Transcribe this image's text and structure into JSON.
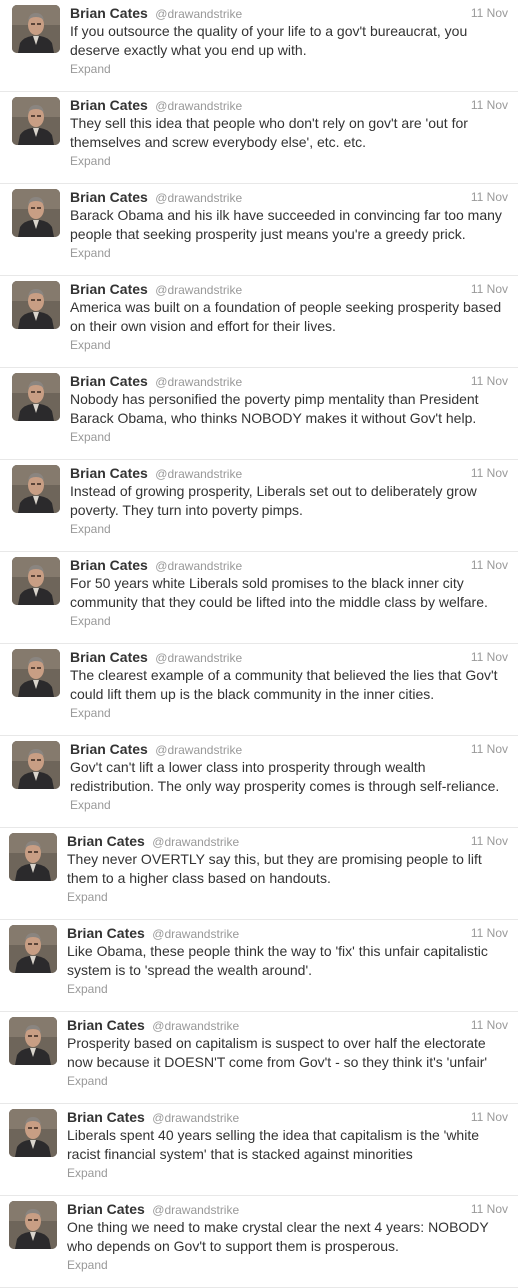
{
  "user": {
    "name": "Brian Cates",
    "handle": "@drawandstrike"
  },
  "expand_label": "Expand",
  "tweets": [
    {
      "time": "11 Nov",
      "text": "If you outsource the quality of your life to a gov't bureaucrat, you deserve exactly what you end up with."
    },
    {
      "time": "11 Nov",
      "text": "They sell this idea that people who don't rely on gov't are 'out for themselves and screw everybody else', etc. etc."
    },
    {
      "time": "11 Nov",
      "text": "Barack Obama and his ilk have succeeded in convincing far too many people that seeking prosperity just means you're a greedy prick."
    },
    {
      "time": "11 Nov",
      "text": "America was built on a foundation of people seeking prosperity based on their own vision and effort for their lives."
    },
    {
      "time": "11 Nov",
      "text": "Nobody has personified the poverty pimp mentality than President Barack Obama, who thinks NOBODY makes it without Gov't help."
    },
    {
      "time": "11 Nov",
      "text": "Instead of growing prosperity, Liberals set out to deliberately grow poverty. They turn into poverty pimps."
    },
    {
      "time": "11 Nov",
      "text": "For 50 years white Liberals sold promises to the black inner city community that they could be lifted into the middle class by welfare."
    },
    {
      "time": "11 Nov",
      "text": "The clearest example of a community that believed the lies that Gov't could lift them up is the black community in the inner cities."
    },
    {
      "time": "11 Nov",
      "text": "Gov't can't lift a lower class into prosperity through wealth redistribution. The only way prosperity comes is through self-reliance."
    },
    {
      "time": "11 Nov",
      "text": "They never OVERTLY say this, but they are promising people to lift them to a higher class based on handouts."
    },
    {
      "time": "11 Nov",
      "text": "Like Obama, these people think the way to 'fix' this unfair capitalistic system is to 'spread the wealth around'."
    },
    {
      "time": "11 Nov",
      "text": "Prosperity based on capitalism is suspect to over half the electorate now because it DOESN'T come from Gov't - so they think it's 'unfair'"
    },
    {
      "time": "11 Nov",
      "text": "Liberals spent 40 years selling the idea that capitalism is the 'white racist financial system' that is stacked against minorities"
    },
    {
      "time": "11 Nov",
      "text": "One thing we need to make crystal clear the next 4 years: NOBODY who depends on Gov't to support them is prosperous."
    }
  ]
}
